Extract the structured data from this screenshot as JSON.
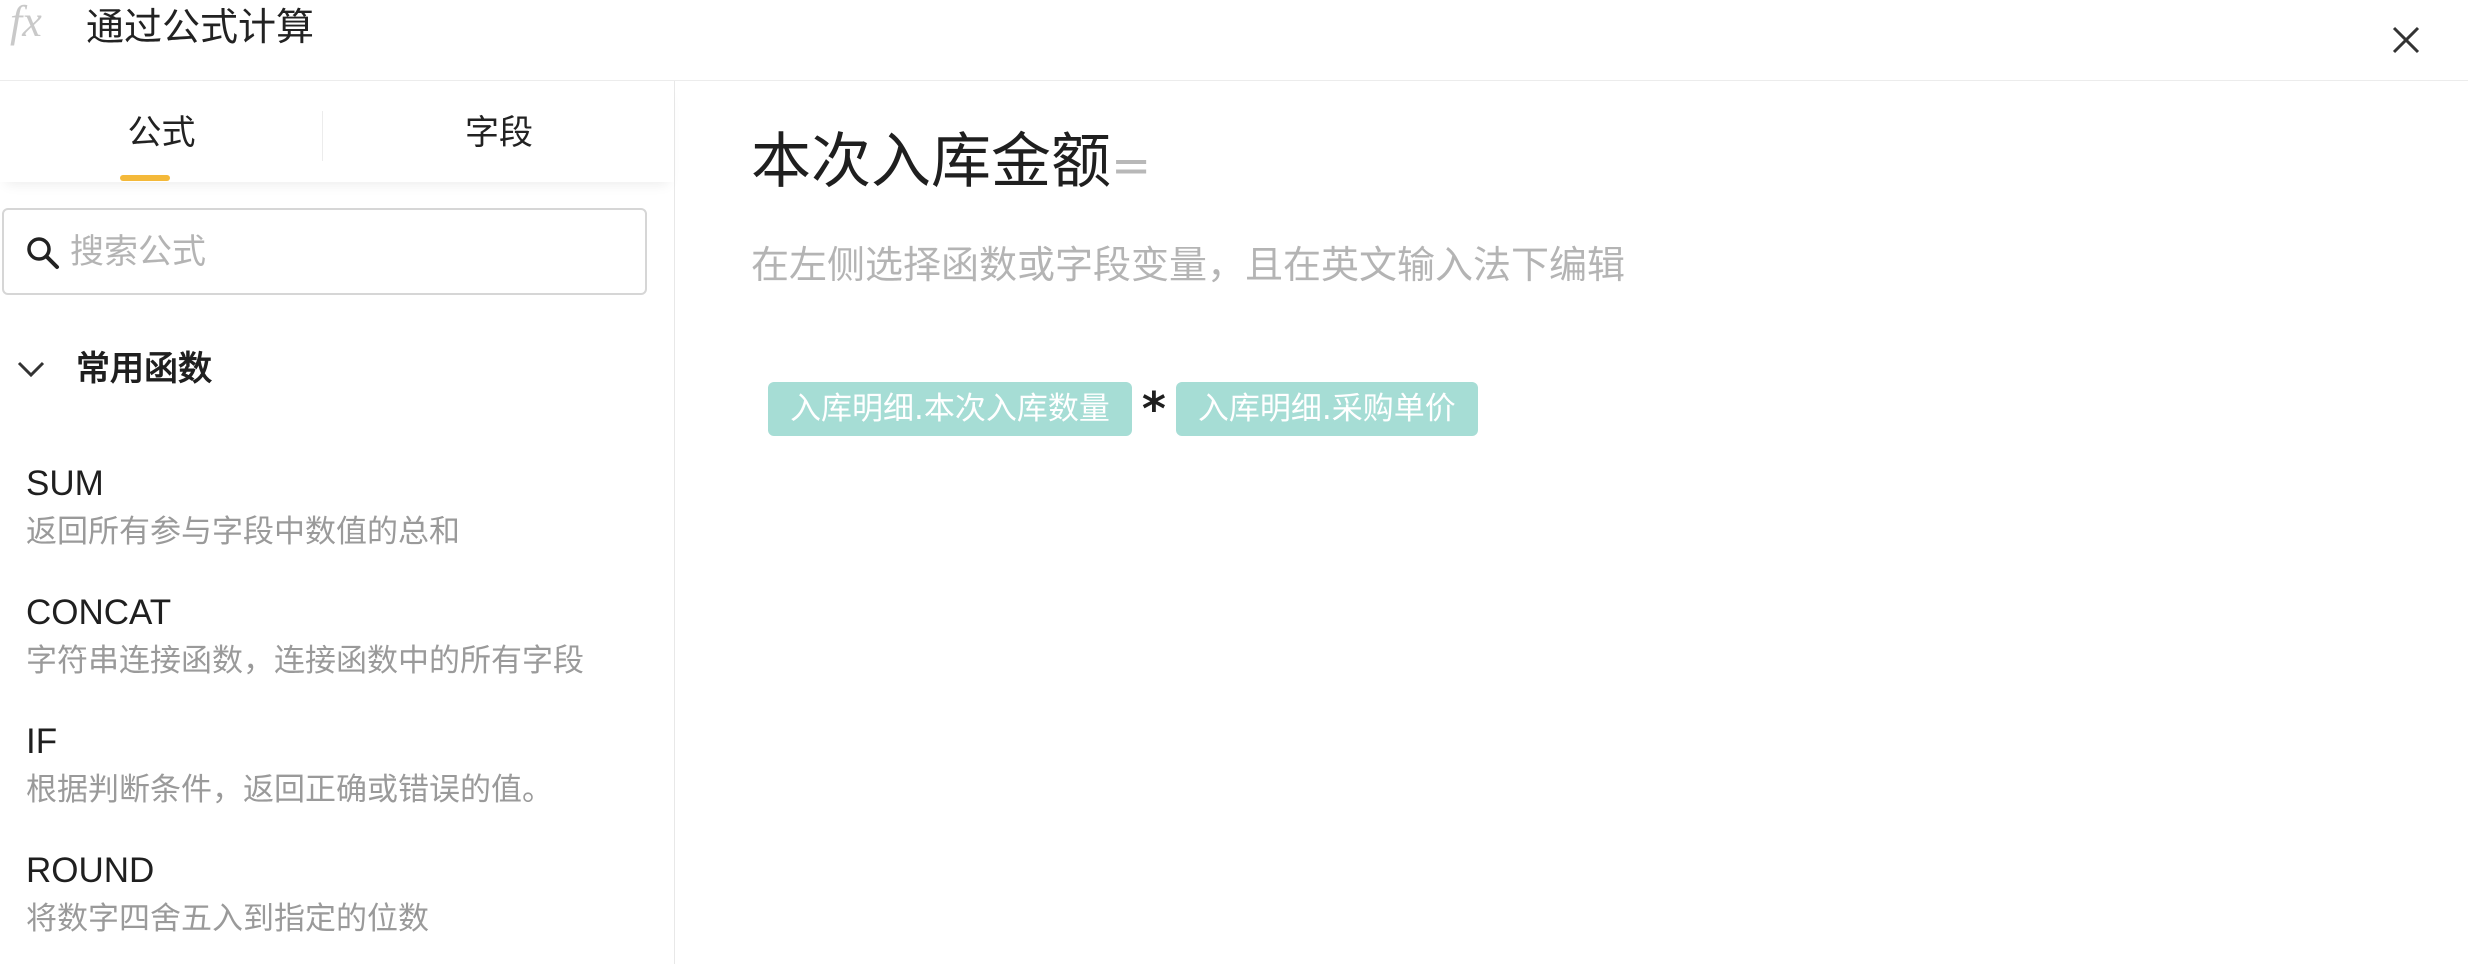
{
  "dialog": {
    "title": "通过公式计算",
    "icon": "function-fx-icon"
  },
  "tabs": [
    {
      "label": "公式",
      "active": true
    },
    {
      "label": "字段",
      "active": false
    }
  ],
  "search": {
    "placeholder": "搜索公式",
    "value": ""
  },
  "function_group": {
    "label": "常用函数",
    "expanded": true,
    "items": [
      {
        "name": "SUM",
        "description": "返回所有参与字段中数值的总和"
      },
      {
        "name": "CONCAT",
        "description": "字符串连接函数，连接函数中的所有字段"
      },
      {
        "name": "IF",
        "description": "根据判断条件，返回正确或错误的值。"
      },
      {
        "name": "ROUND",
        "description": "将数字四舍五入到指定的位数"
      }
    ]
  },
  "editor": {
    "target_field": "本次入库金额",
    "equals": "=",
    "hint": "在左侧选择函数或字段变量，且在英文输入法下编辑",
    "formula": {
      "left_field": "入库明细.本次入库数量",
      "operator": "*",
      "right_field": "入库明细.采购单价"
    }
  },
  "colors": {
    "accent": "#f4b93a",
    "chip_background": "#a6ddd5",
    "chip_text": "#ffffff",
    "muted_text": "#b4b4b4"
  }
}
